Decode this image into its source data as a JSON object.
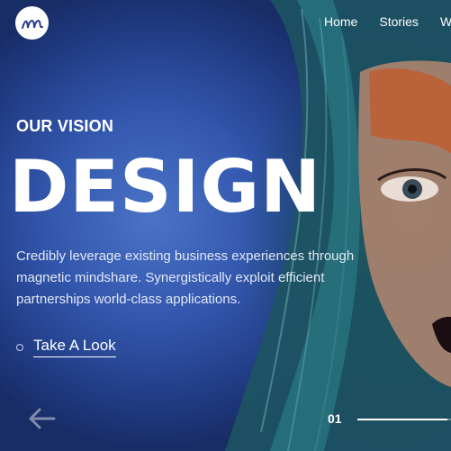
{
  "brand": {
    "logo_icon": "script-m-logo-icon"
  },
  "nav": {
    "items": [
      "Home",
      "Stories",
      "W"
    ]
  },
  "hero": {
    "kicker": "OUR VISION",
    "headline": "DESIGN",
    "body": "Credibly leverage existing business experiences through magnetic mindshare. Synergistically exploit efficient partnerships world-class applications.",
    "cta_label": "Take A Look"
  },
  "slider": {
    "prev_icon": "arrow-left-icon",
    "current": "01",
    "progress": 0.96
  },
  "colors": {
    "background": "#3357ad",
    "text": "#ffffff"
  }
}
